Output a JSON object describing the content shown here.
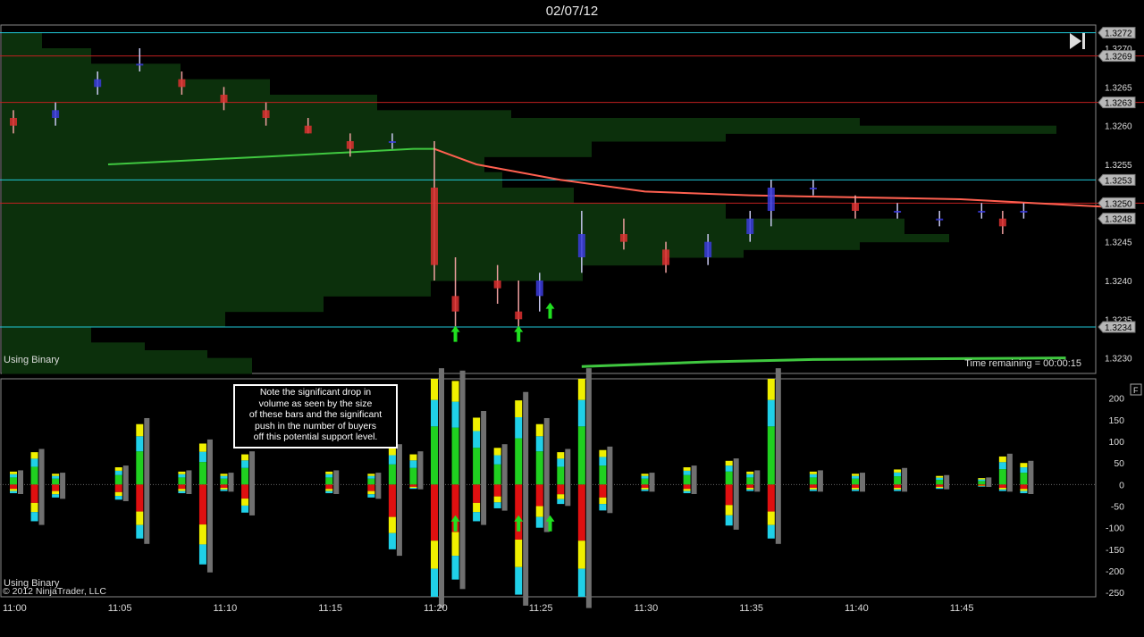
{
  "header": {
    "date": "02/07/12"
  },
  "price_panel": {
    "label": "Using Binary",
    "time_remaining": "Time remaining = 00:00:15",
    "y_ticks": [
      "1.3270",
      "1.3265",
      "1.3260",
      "1.3255",
      "1.3250",
      "1.3245",
      "1.3240",
      "1.3235",
      "1.3230"
    ],
    "y_tick_values": [
      1.327,
      1.3265,
      1.326,
      1.3255,
      1.325,
      1.3245,
      1.324,
      1.3235,
      1.323
    ],
    "cyan_lines": [
      {
        "value": 1.3272,
        "label": "1.3272"
      },
      {
        "value": 1.3253,
        "label": "1.3253"
      },
      {
        "value": 1.3234,
        "label": "1.3234"
      }
    ],
    "red_lines": [
      {
        "value": 1.3269,
        "label": "1.3269"
      },
      {
        "value": 1.3263,
        "label": "1.3263"
      },
      {
        "value": 1.325,
        "label": "1.3250"
      }
    ],
    "price_markers": [
      {
        "value": 1.3248,
        "label": "1.3248"
      }
    ],
    "arrows": [
      {
        "time": "11:21",
        "value": 1.3233
      },
      {
        "time": "11:24",
        "value": 1.3233
      },
      {
        "time": "11:25.5",
        "value": 1.3236
      }
    ],
    "colors": {
      "up_dark": "#3b3bdc",
      "up_light": "#c8c8f0",
      "down_dark": "#dc3030",
      "down_light": "#f0a0a0",
      "ema": "#ff6050",
      "vwap": "#40c840",
      "profile": "#0c300c",
      "cyan": "#20c8d8",
      "red_line": "#c02020"
    },
    "play_icon": "skip-to-end-icon"
  },
  "volume_panel": {
    "label": "Using Binary",
    "copyright": "© 2012 NinjaTrader, LLC",
    "y_ticks": [
      "200",
      "150",
      "100",
      "50",
      "0",
      "-50",
      "-100",
      "-150",
      "-200",
      "-250"
    ],
    "y_tick_values": [
      200,
      150,
      100,
      50,
      0,
      -50,
      -100,
      -150,
      -200,
      -250
    ],
    "note": "Note the significant drop in\nvolume as seen by the size\nof these bars and the significant\npush in the number of buyers\noff this potential support level.",
    "f_button": "F",
    "arrows": [
      {
        "time": "11:21"
      },
      {
        "time": "11:24"
      },
      {
        "time": "11:25.5"
      }
    ],
    "colors": {
      "green": "#20d020",
      "yellow": "#f0f000",
      "cyan": "#20d0e8",
      "red": "#e01010",
      "grey": "#707070"
    }
  },
  "x_axis": {
    "labels": [
      "11:00",
      "11:05",
      "11:10",
      "11:15",
      "11:20",
      "11:25",
      "11:30",
      "11:35",
      "11:40",
      "11:45"
    ]
  },
  "chart_data": [
    {
      "type": "candlestick",
      "title": "02/07/12",
      "x_unit": "time",
      "ylim": [
        1.3228,
        1.3273
      ],
      "candles_approx": [
        {
          "t": "11:00",
          "o": 1.3261,
          "h": 1.3262,
          "l": 1.3259,
          "c": 1.326
        },
        {
          "t": "11:02",
          "o": 1.3261,
          "h": 1.3263,
          "l": 1.326,
          "c": 1.3262
        },
        {
          "t": "11:04",
          "o": 1.3265,
          "h": 1.3267,
          "l": 1.3264,
          "c": 1.3266
        },
        {
          "t": "11:06",
          "o": 1.3268,
          "h": 1.327,
          "l": 1.3267,
          "c": 1.3268
        },
        {
          "t": "11:08",
          "o": 1.3266,
          "h": 1.3267,
          "l": 1.3264,
          "c": 1.3265
        },
        {
          "t": "11:10",
          "o": 1.3264,
          "h": 1.3265,
          "l": 1.3262,
          "c": 1.3263
        },
        {
          "t": "11:12",
          "o": 1.3262,
          "h": 1.3263,
          "l": 1.326,
          "c": 1.3261
        },
        {
          "t": "11:14",
          "o": 1.326,
          "h": 1.3261,
          "l": 1.3259,
          "c": 1.3259
        },
        {
          "t": "11:16",
          "o": 1.3258,
          "h": 1.3259,
          "l": 1.3256,
          "c": 1.3257
        },
        {
          "t": "11:18",
          "o": 1.3258,
          "h": 1.3259,
          "l": 1.3257,
          "c": 1.3258
        },
        {
          "t": "11:20",
          "o": 1.3252,
          "h": 1.3258,
          "l": 1.324,
          "c": 1.3242
        },
        {
          "t": "11:21",
          "o": 1.3238,
          "h": 1.3243,
          "l": 1.3234,
          "c": 1.3236
        },
        {
          "t": "11:23",
          "o": 1.324,
          "h": 1.3242,
          "l": 1.3237,
          "c": 1.3239
        },
        {
          "t": "11:24",
          "o": 1.3236,
          "h": 1.324,
          "l": 1.3234,
          "c": 1.3235
        },
        {
          "t": "11:25",
          "o": 1.3238,
          "h": 1.3241,
          "l": 1.3236,
          "c": 1.324
        },
        {
          "t": "11:27",
          "o": 1.3243,
          "h": 1.3249,
          "l": 1.3241,
          "c": 1.3246
        },
        {
          "t": "11:29",
          "o": 1.3246,
          "h": 1.3248,
          "l": 1.3244,
          "c": 1.3245
        },
        {
          "t": "11:31",
          "o": 1.3244,
          "h": 1.3245,
          "l": 1.3241,
          "c": 1.3242
        },
        {
          "t": "11:33",
          "o": 1.3243,
          "h": 1.3246,
          "l": 1.3242,
          "c": 1.3245
        },
        {
          "t": "11:35",
          "o": 1.3246,
          "h": 1.3249,
          "l": 1.3245,
          "c": 1.3248
        },
        {
          "t": "11:36",
          "o": 1.3249,
          "h": 1.3253,
          "l": 1.3247,
          "c": 1.3252
        },
        {
          "t": "11:38",
          "o": 1.3252,
          "h": 1.3253,
          "l": 1.3251,
          "c": 1.3252
        },
        {
          "t": "11:40",
          "o": 1.325,
          "h": 1.3251,
          "l": 1.3248,
          "c": 1.3249
        },
        {
          "t": "11:42",
          "o": 1.3249,
          "h": 1.325,
          "l": 1.3248,
          "c": 1.3249
        },
        {
          "t": "11:44",
          "o": 1.3248,
          "h": 1.3249,
          "l": 1.3247,
          "c": 1.3248
        },
        {
          "t": "11:46",
          "o": 1.3249,
          "h": 1.325,
          "l": 1.3248,
          "c": 1.3249
        },
        {
          "t": "11:47",
          "o": 1.3248,
          "h": 1.3249,
          "l": 1.3246,
          "c": 1.3247
        },
        {
          "t": "11:48",
          "o": 1.3249,
          "h": 1.325,
          "l": 1.3248,
          "c": 1.3249
        }
      ]
    },
    {
      "type": "bar",
      "title": "",
      "ylim": [
        -260,
        245
      ],
      "x_unit": "time",
      "bars_approx": [
        {
          "t": "11:00",
          "up": 30,
          "down": -20
        },
        {
          "t": "11:01",
          "up": 75,
          "down": -85
        },
        {
          "t": "11:02",
          "up": 25,
          "down": -30
        },
        {
          "t": "11:05",
          "up": 40,
          "down": -35
        },
        {
          "t": "11:06",
          "up": 140,
          "down": -125
        },
        {
          "t": "11:08",
          "up": 30,
          "down": -20
        },
        {
          "t": "11:09",
          "up": 95,
          "down": -185
        },
        {
          "t": "11:10",
          "up": 25,
          "down": -15
        },
        {
          "t": "11:11",
          "up": 70,
          "down": -65
        },
        {
          "t": "11:15",
          "up": 30,
          "down": -20
        },
        {
          "t": "11:17",
          "up": 25,
          "down": -30
        },
        {
          "t": "11:18",
          "up": 85,
          "down": -150
        },
        {
          "t": "11:19",
          "up": 70,
          "down": -10
        },
        {
          "t": "11:20",
          "up": 245,
          "down": -260
        },
        {
          "t": "11:21",
          "up": 240,
          "down": -220
        },
        {
          "t": "11:22",
          "up": 155,
          "down": -85
        },
        {
          "t": "11:23",
          "up": 85,
          "down": -55
        },
        {
          "t": "11:24",
          "up": 195,
          "down": -255
        },
        {
          "t": "11:25",
          "up": 140,
          "down": -100
        },
        {
          "t": "11:26",
          "up": 75,
          "down": -45
        },
        {
          "t": "11:27",
          "up": 245,
          "down": -260
        },
        {
          "t": "11:28",
          "up": 80,
          "down": -60
        },
        {
          "t": "11:30",
          "up": 25,
          "down": -15
        },
        {
          "t": "11:32",
          "up": 40,
          "down": -20
        },
        {
          "t": "11:34",
          "up": 55,
          "down": -95
        },
        {
          "t": "11:35",
          "up": 30,
          "down": -15
        },
        {
          "t": "11:36",
          "up": 245,
          "down": -125
        },
        {
          "t": "11:38",
          "up": 30,
          "down": -15
        },
        {
          "t": "11:40",
          "up": 25,
          "down": -15
        },
        {
          "t": "11:42",
          "up": 35,
          "down": -15
        },
        {
          "t": "11:44",
          "up": 20,
          "down": -10
        },
        {
          "t": "11:46",
          "up": 15,
          "down": -5
        },
        {
          "t": "11:47",
          "up": 65,
          "down": -15
        },
        {
          "t": "11:48",
          "up": 50,
          "down": -20
        }
      ]
    }
  ]
}
